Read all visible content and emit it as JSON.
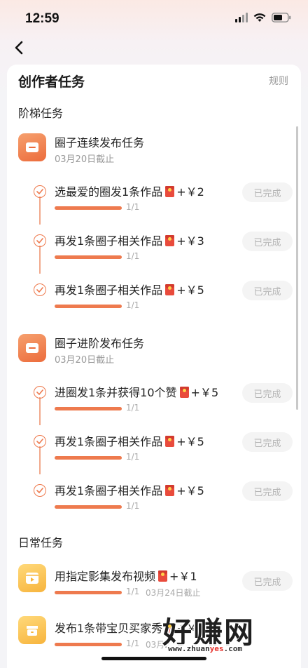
{
  "status_bar": {
    "time": "12:59"
  },
  "card": {
    "title": "创作者任务",
    "rules_label": "规则"
  },
  "sections": {
    "ladder_title": "阶梯任务",
    "daily_title": "日常任务"
  },
  "groups": [
    {
      "title": "圈子连续发布任务",
      "deadline": "03月20日截止",
      "tasks": [
        {
          "label": "选最爱的圈发1条作品",
          "reward": "+￥2",
          "progress": "1/1",
          "progress_fraction": 1.0,
          "button": "已完成"
        },
        {
          "label": "再发1条圈子相关作品",
          "reward": "+￥3",
          "progress": "1/1",
          "progress_fraction": 1.0,
          "button": "已完成"
        },
        {
          "label": "再发1条圈子相关作品",
          "reward": "+￥5",
          "progress": "1/1",
          "progress_fraction": 1.0,
          "button": "已完成"
        }
      ]
    },
    {
      "title": "圈子进阶发布任务",
      "deadline": "03月20日截止",
      "tasks": [
        {
          "label": "进圈发1条并获得10个赞",
          "reward": "+￥5",
          "progress": "1/1",
          "progress_fraction": 1.0,
          "button": "已完成"
        },
        {
          "label": "再发1条圈子相关作品",
          "reward": "+￥5",
          "progress": "1/1",
          "progress_fraction": 1.0,
          "button": "已完成"
        },
        {
          "label": "再发1条圈子相关作品",
          "reward": "+￥5",
          "progress": "1/1",
          "progress_fraction": 1.0,
          "button": "已完成"
        }
      ]
    }
  ],
  "daily_tasks": [
    {
      "label": "用指定影集发布视频",
      "reward": "+￥1",
      "progress": "1/1",
      "progress_fraction": 1.0,
      "date": "03月24日截止",
      "button": "已完成",
      "icon": "play-icon"
    },
    {
      "label": "发布1条带宝贝买家秀",
      "reward": "+￥2",
      "progress": "1/1",
      "progress_fraction": 1.0,
      "date": "03月2",
      "button": "",
      "icon": "shop-icon"
    }
  ],
  "watermark": {
    "logo": "好赚网",
    "url_prefix": "www.zhuan",
    "url_highlight": "yes",
    "url_suffix": ".com"
  },
  "colors": {
    "accent": "#ee7a4e",
    "icon_orange": "#ec6c3c",
    "icon_yellow": "#f7b43d",
    "done_bg": "#f4f4f4",
    "done_text": "#b5b5b5"
  }
}
